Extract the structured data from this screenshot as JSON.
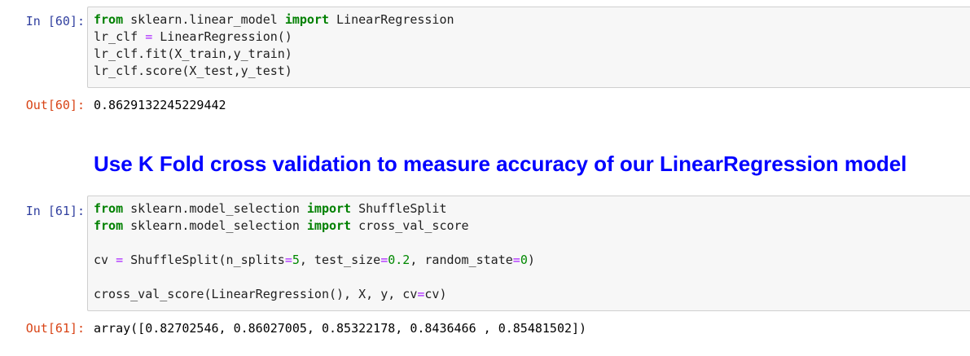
{
  "cells": [
    {
      "in_prompt": "In [60]:",
      "out_prompt": "Out[60]:",
      "code": {
        "line1": {
          "kw1": "from",
          "mod": " sklearn.linear_model ",
          "kw2": "import",
          "name": " LinearRegression"
        },
        "line2": {
          "lhs": "lr_clf ",
          "op": "=",
          "rhs": " LinearRegression()"
        },
        "line3": "lr_clf.fit(X_train,y_train)",
        "line4": "lr_clf.score(X_test,y_test)"
      },
      "output": "0.8629132245229442"
    },
    {
      "in_prompt": "In [61]:",
      "out_prompt": "Out[61]:",
      "code": {
        "line1": {
          "kw1": "from",
          "mod": " sklearn.model_selection ",
          "kw2": "import",
          "name": " ShuffleSplit"
        },
        "line2": {
          "kw1": "from",
          "mod": " sklearn.model_selection ",
          "kw2": "import",
          "name": " cross_val_score"
        },
        "line3": {
          "a": "cv ",
          "op1": "=",
          "b": " ShuffleSplit(n_splits",
          "op2": "=",
          "n1": "5",
          "c": ", test_size",
          "op3": "=",
          "n2": "0.2",
          "d": ", random_state",
          "op4": "=",
          "n3": "0",
          "e": ")"
        },
        "line4": {
          "a": "cross_val_score(LinearRegression(), X, y, cv",
          "op": "=",
          "b": "cv)"
        }
      },
      "output": "array([0.82702546, 0.86027005, 0.85322178, 0.8436466 , 0.85481502])"
    }
  ],
  "markdown": {
    "heading": "Use K Fold cross validation to measure accuracy of our LinearRegression model"
  },
  "colors": {
    "in_prompt": "#303f9f",
    "out_prompt": "#d84315",
    "keyword": "#008000",
    "operator": "#aa22ff",
    "number": "#008800",
    "heading": "#0000ff",
    "input_bg": "#f7f7f7",
    "input_border": "#cfcfcf"
  }
}
